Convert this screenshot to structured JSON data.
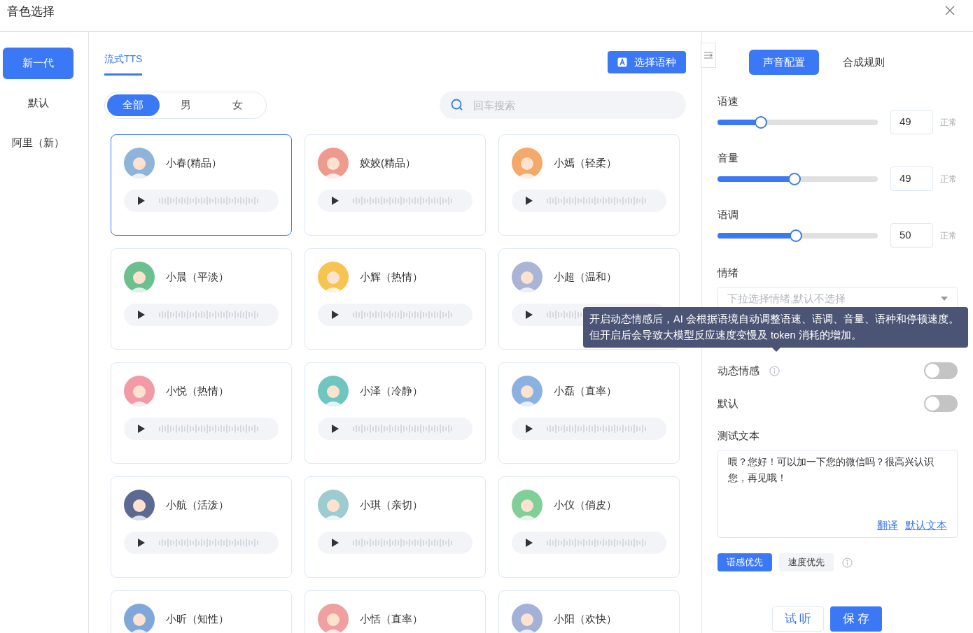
{
  "window": {
    "title": "音色选择"
  },
  "sidebar": {
    "items": [
      {
        "label": "新一代",
        "selected": true
      },
      {
        "label": "默认",
        "selected": false
      },
      {
        "label": "阿里（新）",
        "selected": false
      }
    ]
  },
  "tabs": [
    {
      "label": "流式TTS",
      "selected": true
    }
  ],
  "language_button": "选择语种",
  "gender_filter": [
    {
      "label": "全部",
      "selected": true
    },
    {
      "label": "男",
      "selected": false
    },
    {
      "label": "女",
      "selected": false
    }
  ],
  "search": {
    "placeholder": "回车搜索"
  },
  "voices": [
    {
      "name": "小春(精品）",
      "color": "#8fb4d9",
      "selected": true
    },
    {
      "name": "姣姣(精品）",
      "color": "#ef9a8e",
      "selected": false
    },
    {
      "name": "小嫣（轻柔）",
      "color": "#f4a86a",
      "selected": false
    },
    {
      "name": "小晨（平淡）",
      "color": "#6cc08f",
      "selected": false
    },
    {
      "name": "小辉（热情）",
      "color": "#f5c451",
      "selected": false
    },
    {
      "name": "小超（温和）",
      "color": "#a9b4d6",
      "selected": false
    },
    {
      "name": "小悦（热情）",
      "color": "#f29aa5",
      "selected": false
    },
    {
      "name": "小泽（冷静）",
      "color": "#6fc5c0",
      "selected": false
    },
    {
      "name": "小磊（直率）",
      "color": "#8ab1e0",
      "selected": false
    },
    {
      "name": "小航（活泼）",
      "color": "#5c6a93",
      "selected": false
    },
    {
      "name": "小琪（亲切）",
      "color": "#9ccbd0",
      "selected": false
    },
    {
      "name": "小仪（俏皮）",
      "color": "#7fcf97",
      "selected": false
    },
    {
      "name": "小昕（知性）",
      "color": "#7fa8d8",
      "selected": false
    },
    {
      "name": "小恬（直率）",
      "color": "#f0a0a0",
      "selected": false
    },
    {
      "name": "小阳（欢快）",
      "color": "#a3b0d8",
      "selected": false
    }
  ],
  "config_tabs": [
    {
      "label": "声音配置",
      "selected": true
    },
    {
      "label": "合成规则",
      "selected": false
    }
  ],
  "sliders": [
    {
      "label": "语速",
      "level": 0.27,
      "value": "49",
      "reading": "正常"
    },
    {
      "label": "音量",
      "level": 0.48,
      "value": "49",
      "reading": "正常"
    },
    {
      "label": "语调",
      "level": 0.49,
      "value": "50",
      "reading": "正常"
    }
  ],
  "emotion": {
    "label": "情绪",
    "placeholder": "下拉选择情绪,默认不选择"
  },
  "toggles": [
    {
      "label": "动态情感",
      "on": false,
      "info": true
    },
    {
      "label": "默认",
      "on": false,
      "info": false
    }
  ],
  "tooltip": "开启动态情感后，AI 会根据语境自动调整语速、语调、音量、语种和停顿速度。但开启后会导致大模型反应速度变慢及 token 消耗的增加。",
  "test_text": {
    "label": "测试文本",
    "value": "喂？您好！可以加一下您的微信吗？很高兴认识您，再见哦！",
    "links": [
      "翻译",
      "默认文本"
    ]
  },
  "priority": [
    {
      "label": "语感优先",
      "selected": true
    },
    {
      "label": "速度优先",
      "selected": false
    }
  ],
  "buttons": {
    "listen": "试 听",
    "save": "保 存"
  }
}
